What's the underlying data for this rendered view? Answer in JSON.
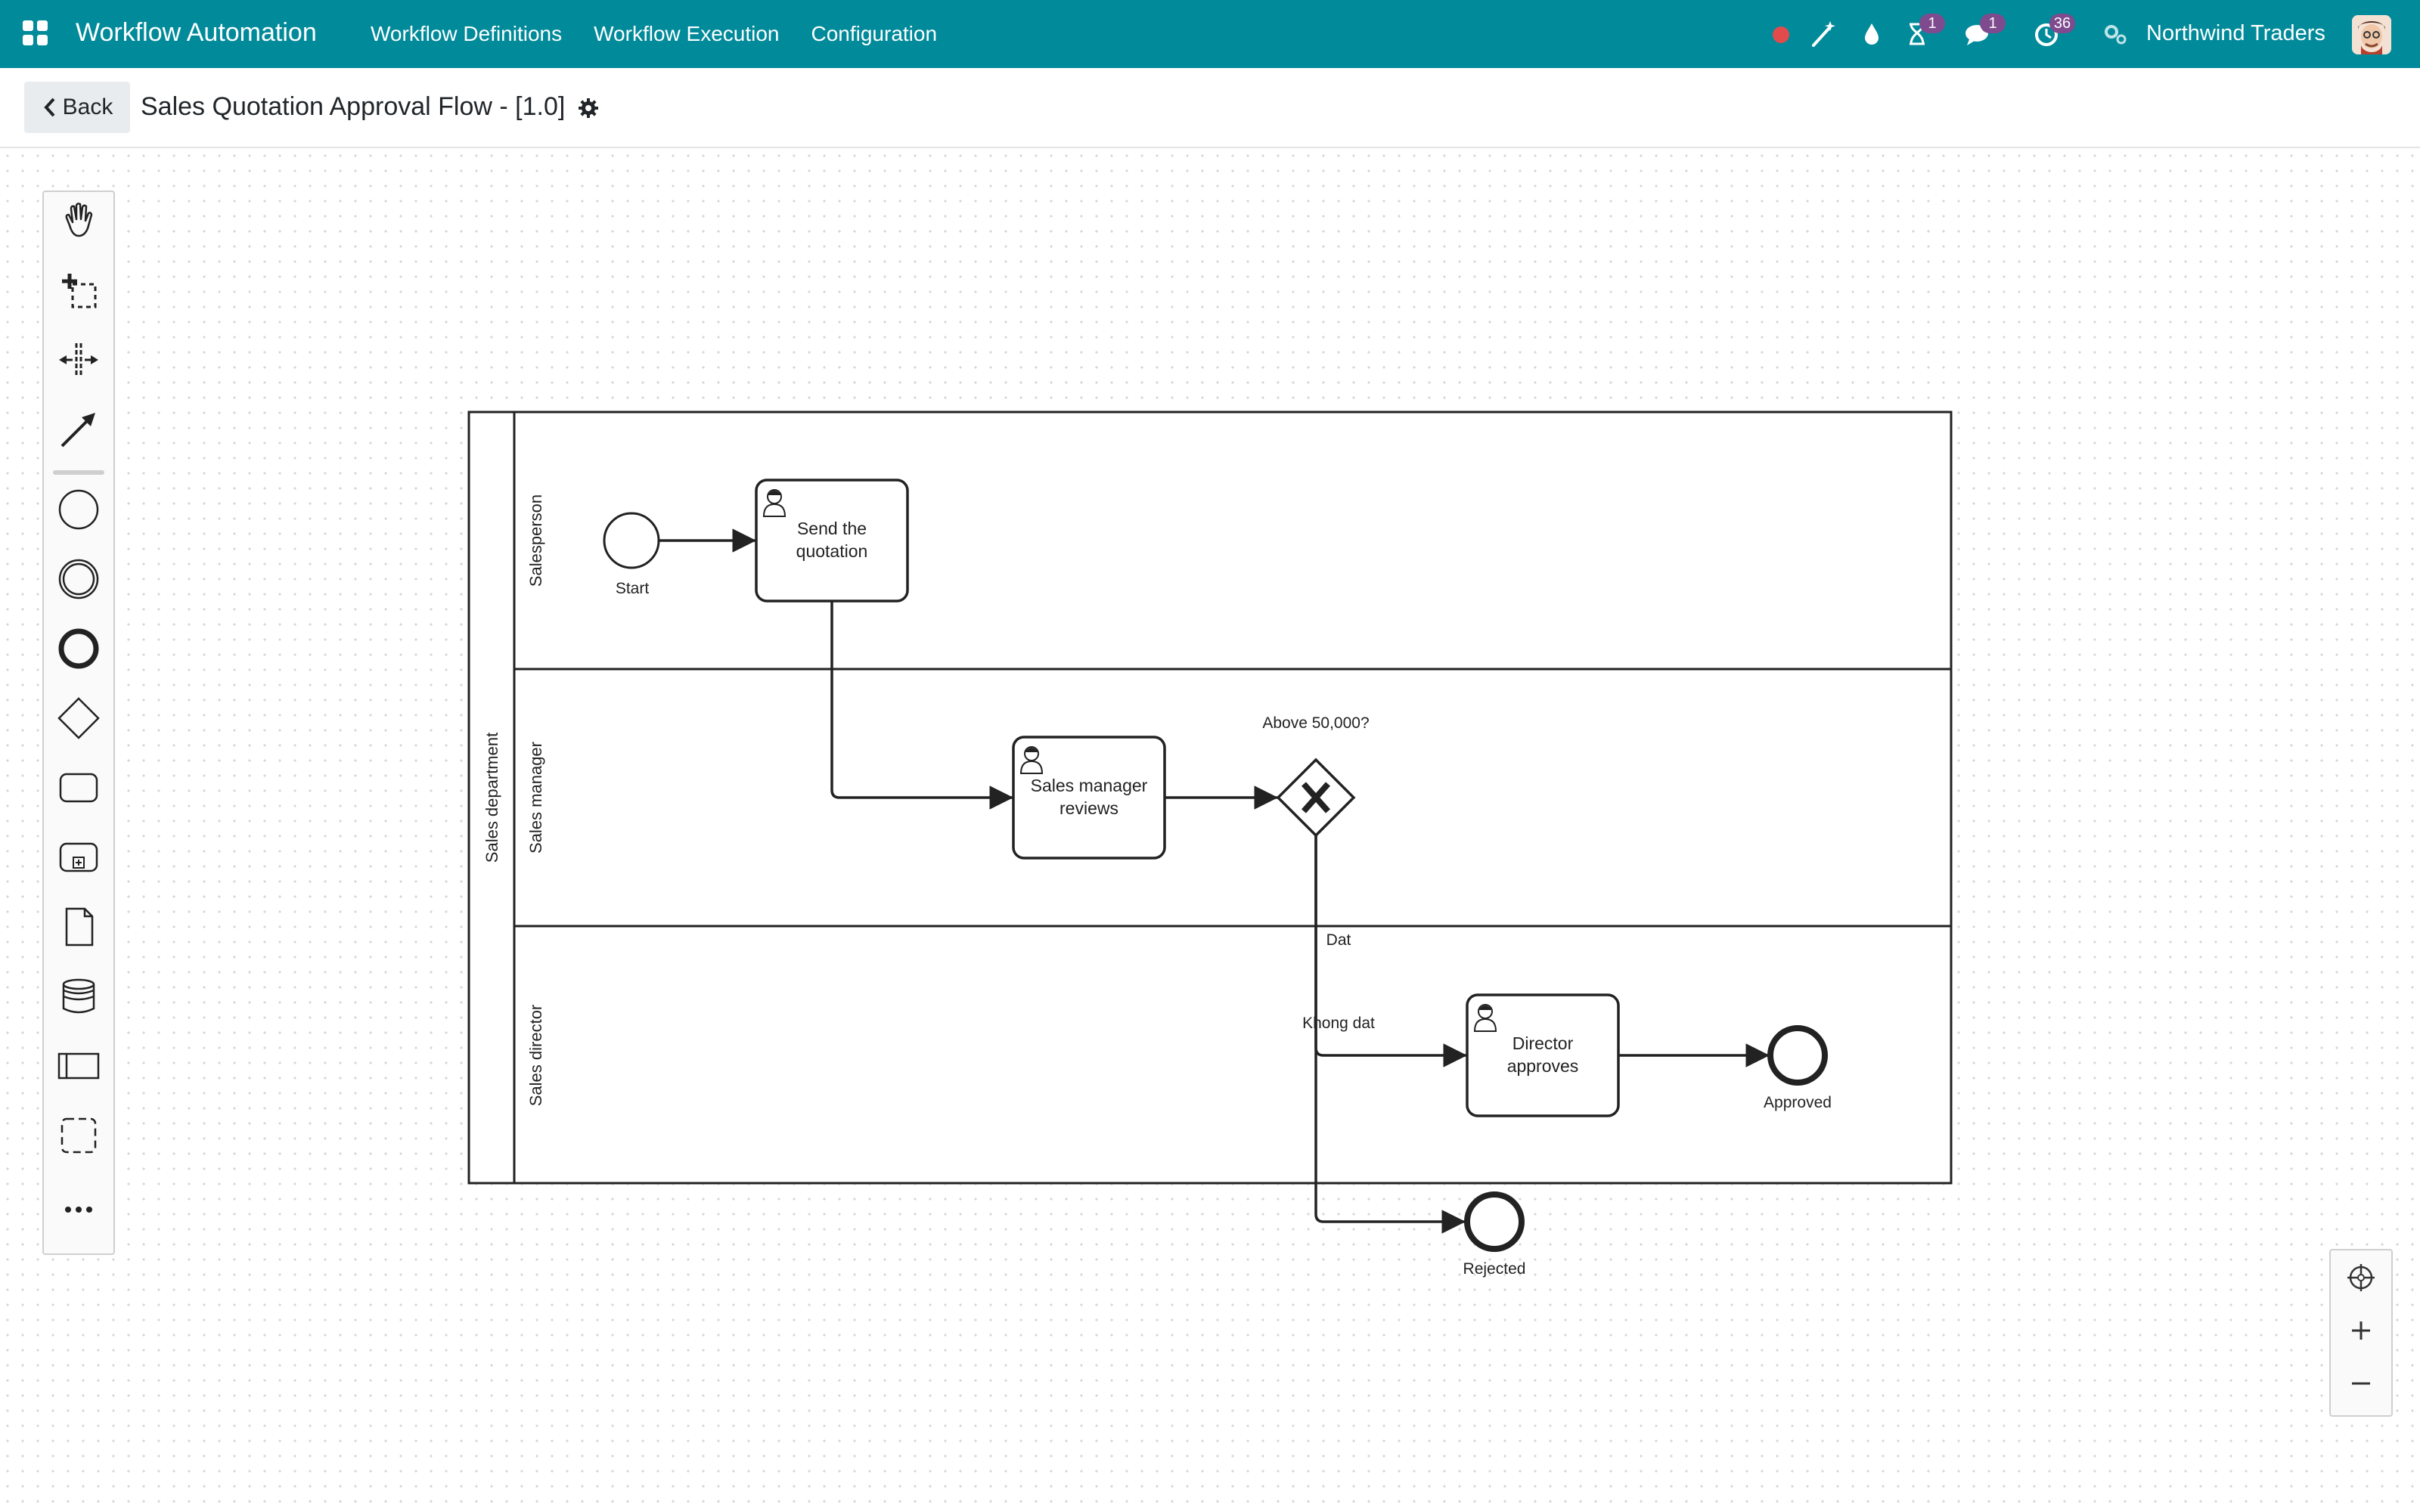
{
  "navbar": {
    "brand": "Workflow Automation",
    "menu": [
      "Workflow Definitions",
      "Workflow Execution",
      "Configuration"
    ],
    "badges": {
      "activity": "1",
      "messages": "1",
      "clock": "36"
    },
    "company": "Northwind Traders",
    "icons": [
      "apps-grid-icon",
      "record-dot-icon",
      "magic-wand-icon",
      "drop-icon",
      "hourglass-icon",
      "chat-icon",
      "clock-icon",
      "settings-cogs-icon",
      "avatar"
    ]
  },
  "control": {
    "back_label": "Back",
    "title": "Sales Quotation Approval Flow - [1.0]"
  },
  "palette": {
    "tools": [
      "hand-tool-icon",
      "lasso-tool-icon",
      "space-tool-icon",
      "connect-tool-icon",
      "start-event-icon",
      "intermediate-event-icon",
      "end-event-icon",
      "gateway-icon",
      "task-icon",
      "subprocess-icon",
      "data-object-icon",
      "data-store-icon",
      "participant-icon",
      "group-icon",
      "more-icon"
    ]
  },
  "diagram": {
    "pool_label": "Sales department",
    "lanes": [
      "Salesperson",
      "Sales manager",
      "Sales director"
    ],
    "tasks": {
      "send_l1": "Send the",
      "send_l2": "quotation",
      "review_l1": "Sales manager",
      "review_l2": "reviews",
      "director_l1": "Director",
      "director_l2": "approves"
    },
    "events": {
      "start": "Start",
      "approved": "Approved",
      "rejected": "Rejected"
    },
    "gateway_label": "Above 50,000?",
    "flow_labels": {
      "pass": "Dat",
      "fail": "Khong dat"
    }
  },
  "zoom": {
    "icons": [
      "reset-view-icon",
      "zoom-in-icon",
      "zoom-out-icon"
    ]
  },
  "colors": {
    "navbar": "#018a9a",
    "badge": "#7d4b8e",
    "record": "#e24b4b"
  }
}
